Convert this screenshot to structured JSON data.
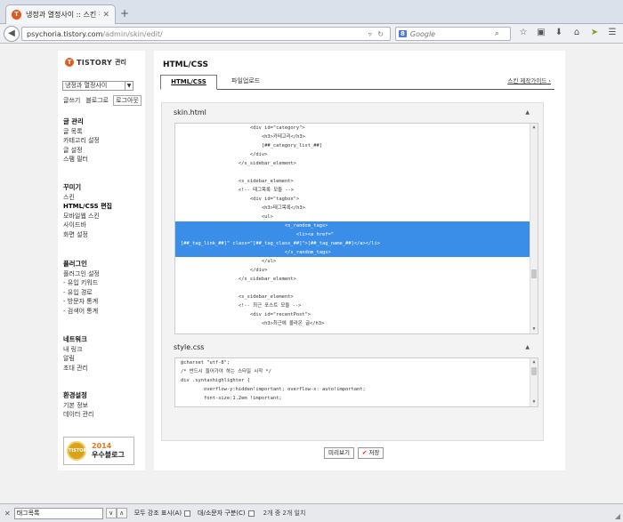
{
  "browser": {
    "tab_title": "냉정과 열정사이 :: 스킨 편…",
    "tab_favicon": "T",
    "url_lead": "psychoria.tistory.com",
    "url_rest": "/admin/skin/edit/",
    "search_engine": "8",
    "search_placeholder": "Google"
  },
  "sidebar": {
    "logo": "TISTORY",
    "logo_sub": "관리",
    "blog_select": "냉정과 열정사이",
    "quick": {
      "write": "글쓰기",
      "blog": "블로그로",
      "logout": "로그아웃"
    },
    "sections": [
      {
        "head": "글 관리",
        "items": [
          "글 목록",
          "카테고리 설정",
          "글 설정",
          "스팸 필터"
        ]
      },
      {
        "head": "꾸미기",
        "items": [
          "스킨",
          "HTML/CSS 편집",
          "모바일웹 스킨",
          "사이드바",
          "화면 설정"
        ]
      },
      {
        "head": "플러그인",
        "items": [
          "플러그인 설정",
          "- 유입 키워드",
          "- 유입 경로",
          "- 방문자 통계",
          "- 검색어 통계"
        ]
      },
      {
        "head": "네트워크",
        "items": [
          "내 링크",
          "알림",
          "초대 관리"
        ]
      },
      {
        "head": "환경설정",
        "items": [
          "기본 정보",
          "데이터 관리"
        ]
      }
    ],
    "award": {
      "year": "2014",
      "label": "우수블로그",
      "medal": "TISTORY"
    }
  },
  "main": {
    "title": "HTML/CSS",
    "tabs": {
      "html_css": "HTML/CSS",
      "upload": "파일업로드",
      "guide": "스킨 제작가이드 ›"
    },
    "skin_title": "skin.html",
    "style_title": "style.css",
    "skin_code": [
      "                        <div id=\"category\">",
      "                            <h3>카테고리</h3>",
      "                            [##_category_list_##]",
      "                        </div>",
      "                    </s_sidebar_element>",
      "",
      "                    <s_sidebar_element>",
      "                    <!-- 태그목록 모듈 -->",
      "                        <div id=\"tagbox\">",
      "                            <h3>태그목록</h3>",
      "                            <ul>",
      "                                    <s_random_tags>",
      "                                        <li><a href=\"",
      "[##_tag_link_##]\" class=\"[##_tag_class_##]\">[##_tag_name_##]</a></li>",
      "                                    </s_random_tags>",
      "                            </ul>",
      "                        </div>",
      "                    </s_sidebar_element>",
      "",
      "                    <s_sidebar_element>",
      "                    <!-- 최근 포스트 모듈 -->",
      "                        <div id=\"recentPost\">",
      "                            <h3>최근에 올라온 글</h3>"
    ],
    "style_code": [
      "@charset \"utf-8\";",
      "/* 반드시 들어가야 하는 스타일 시작 */",
      "div .syntaxhighlighter {",
      "        overflow-y:hidden!important; overflow-x: auto!important;",
      "        font-size:1.2em !important;"
    ],
    "preview_btn": "미리보기",
    "save_btn": "저장"
  },
  "findbar": {
    "value": "태그목록",
    "highlight_all": "모두 강조 표시(A)",
    "match_case": "대/소문자 구분(C)",
    "status": "2개 중 2개 일치"
  }
}
